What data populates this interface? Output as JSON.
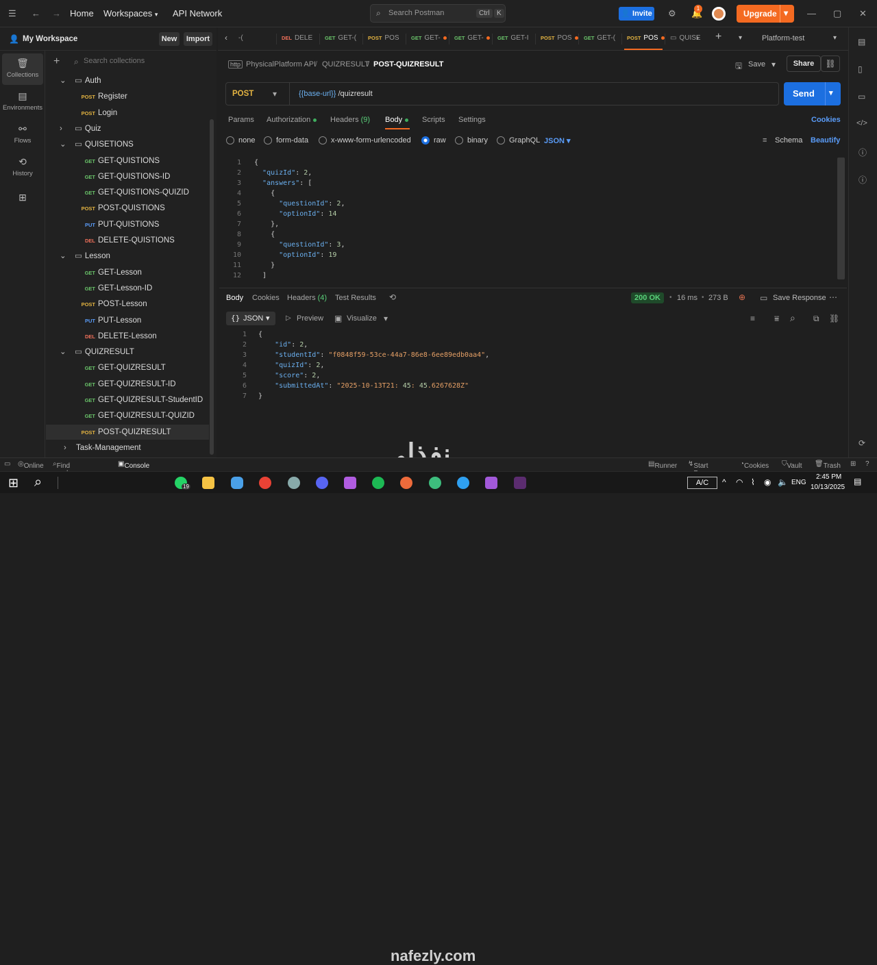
{
  "topbar": {
    "home": "Home",
    "workspaces": "Workspaces",
    "api_network": "API Network",
    "search_placeholder": "Search Postman",
    "shortcut_ctrl": "Ctrl",
    "shortcut_k": "K",
    "invite": "Invite",
    "notification_count": "1",
    "upgrade": "Upgrade"
  },
  "sidebar": {
    "workspace": "My Workspace",
    "new": "New",
    "import": "Import",
    "search_placeholder": "Search collections",
    "rail": [
      {
        "label": "Collections",
        "icon": "collections-icon"
      },
      {
        "label": "Environments",
        "icon": "environments-icon"
      },
      {
        "label": "Flows",
        "icon": "flows-icon"
      },
      {
        "label": "History",
        "icon": "history-icon"
      }
    ],
    "tree": [
      {
        "type": "folder",
        "label": "Auth",
        "open": true,
        "level": 1
      },
      {
        "type": "req",
        "method": "POST",
        "label": "Register",
        "level": 2
      },
      {
        "type": "req",
        "method": "POST",
        "label": "Login",
        "level": 2
      },
      {
        "type": "folder",
        "label": "Quiz",
        "open": false,
        "level": 1
      },
      {
        "type": "folder",
        "label": "QUISETIONS",
        "open": true,
        "level": 1
      },
      {
        "type": "req",
        "method": "GET",
        "label": "GET-QUISTIONS",
        "level": 2
      },
      {
        "type": "req",
        "method": "GET",
        "label": "GET-QUISTIONS-ID",
        "level": 2
      },
      {
        "type": "req",
        "method": "GET",
        "label": "GET-QUISTIONS-QUIZID",
        "level": 2
      },
      {
        "type": "req",
        "method": "POST",
        "label": "POST-QUISTIONS",
        "level": 2
      },
      {
        "type": "req",
        "method": "PUT",
        "label": "PUT-QUISTIONS",
        "level": 2
      },
      {
        "type": "req",
        "method": "DEL",
        "label": "DELETE-QUISTIONS",
        "level": 2
      },
      {
        "type": "folder",
        "label": "Lesson",
        "open": true,
        "level": 1
      },
      {
        "type": "req",
        "method": "GET",
        "label": "GET-Lesson",
        "level": 2
      },
      {
        "type": "req",
        "method": "GET",
        "label": "GET-Lesson-ID",
        "level": 2
      },
      {
        "type": "req",
        "method": "POST",
        "label": "POST-Lesson",
        "level": 2
      },
      {
        "type": "req",
        "method": "PUT",
        "label": "PUT-Lesson",
        "level": 2
      },
      {
        "type": "req",
        "method": "DEL",
        "label": "DELETE-Lesson",
        "level": 2
      },
      {
        "type": "folder",
        "label": "QUIZRESULT",
        "open": true,
        "level": 1
      },
      {
        "type": "req",
        "method": "GET",
        "label": "GET-QUIZRESULT",
        "level": 2
      },
      {
        "type": "req",
        "method": "GET",
        "label": "GET-QUIZRESULT-ID",
        "level": 2
      },
      {
        "type": "req",
        "method": "GET",
        "label": "GET-QUIZRESULT-StudentID",
        "level": 2
      },
      {
        "type": "req",
        "method": "GET",
        "label": "GET-QUIZRESULT-QUIZID",
        "level": 2
      },
      {
        "type": "req",
        "method": "POST",
        "label": "POST-QUIZRESULT",
        "level": 2,
        "selected": true
      },
      {
        "type": "collection",
        "label": "Task-Management",
        "open": false,
        "level": 0
      }
    ]
  },
  "tabs": [
    {
      "method": "",
      "label": "-(",
      "dot": false
    },
    {
      "method": "DEL",
      "label": "DELE",
      "dot": false
    },
    {
      "method": "GET",
      "label": "GET-(",
      "dot": false
    },
    {
      "method": "POST",
      "label": "POS",
      "dot": false
    },
    {
      "method": "GET",
      "label": "GET-",
      "dot": true
    },
    {
      "method": "GET",
      "label": "GET-",
      "dot": true
    },
    {
      "method": "GET",
      "label": "GET-I",
      "dot": false
    },
    {
      "method": "POST",
      "label": "POS",
      "dot": true
    },
    {
      "method": "GET",
      "label": "GET-(",
      "dot": false
    },
    {
      "method": "POST",
      "label": "POS",
      "dot": true,
      "active": true
    },
    {
      "method": "",
      "label": "QUISE",
      "dot": false
    }
  ],
  "environment": "Platform-test",
  "breadcrumb": {
    "collection": "PhysicalPlatform API",
    "folder": "QUIZRESULT",
    "request": "POST-QUIZRESULT"
  },
  "actions": {
    "save": "Save",
    "share": "Share"
  },
  "request": {
    "method": "POST",
    "url_var": "{{base-url}}",
    "url_path": " /quizresult",
    "send": "Send"
  },
  "req_tabs": {
    "params": "Params",
    "authorization": "Authorization",
    "headers": "Headers",
    "headers_count": "(9)",
    "body": "Body",
    "scripts": "Scripts",
    "settings": "Settings",
    "cookies": "Cookies"
  },
  "body_types": {
    "none": "none",
    "form_data": "form-data",
    "urlencoded": "x-www-form-urlencoded",
    "raw": "raw",
    "binary": "binary",
    "graphql": "GraphQL",
    "format": "JSON",
    "schema": "Schema",
    "beautify": "Beautify"
  },
  "request_body": [
    {
      "n": "1",
      "t": "{"
    },
    {
      "n": "2",
      "t": "  \"quizId\": 2,"
    },
    {
      "n": "3",
      "t": "  \"answers\": ["
    },
    {
      "n": "4",
      "t": "    {"
    },
    {
      "n": "5",
      "t": "      \"questionId\": 2,"
    },
    {
      "n": "6",
      "t": "      \"optionId\": 14"
    },
    {
      "n": "7",
      "t": "    },"
    },
    {
      "n": "8",
      "t": "    {"
    },
    {
      "n": "9",
      "t": "      \"questionId\": 3,"
    },
    {
      "n": "10",
      "t": "      \"optionId\": 19"
    },
    {
      "n": "11",
      "t": "    }"
    },
    {
      "n": "12",
      "t": "  ]"
    }
  ],
  "response": {
    "body": "Body",
    "cookies": "Cookies",
    "headers": "Headers",
    "headers_count": "(4)",
    "test_results": "Test Results",
    "status": "200 OK",
    "time": "16 ms",
    "size": "273 B",
    "save_response": "Save Response",
    "format": "JSON",
    "preview": "Preview",
    "visualize": "Visualize",
    "lines": [
      {
        "n": "1",
        "t": "{"
      },
      {
        "n": "2",
        "t": "    \"id\": 2,"
      },
      {
        "n": "3",
        "t": "    \"studentId\": \"f0848f59-53ce-44a7-86e8-6ee89edb0aa4\","
      },
      {
        "n": "4",
        "t": "    \"quizId\": 2,"
      },
      {
        "n": "5",
        "t": "    \"score\": 2,"
      },
      {
        "n": "6",
        "t": "    \"submittedAt\": \"2025-10-13T21:45:45.6267628Z\""
      },
      {
        "n": "7",
        "t": "}"
      }
    ]
  },
  "statusbar": {
    "online": "Online",
    "find_replace": "Find and replace",
    "console": "Console",
    "runner": "Runner",
    "start_proxy": "Start Proxy",
    "cookies": "Cookies",
    "vault": "Vault",
    "trash": "Trash"
  },
  "taskbar": {
    "whatsapp_badge": "19",
    "keyboard": "A/C",
    "lang": "ENG",
    "time": "2:45 PM",
    "date": "10/13/2025"
  },
  "watermark": {
    "arabic": "نفذلي",
    "latin": "nafezly.com"
  }
}
